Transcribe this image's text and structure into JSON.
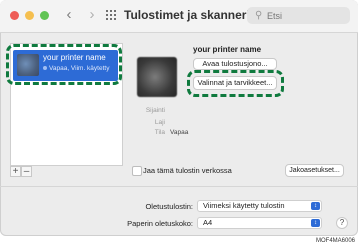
{
  "window": {
    "title": "Tulostimet ja skannerit",
    "search_placeholder": "Etsi"
  },
  "sidebar": {
    "printer": {
      "name": "your printer name",
      "status": "Vapaa, Viim. käytetty"
    },
    "add_label": "+",
    "remove_label": "–"
  },
  "detail": {
    "printer_name": "your printer name",
    "open_queue_label": "Avaa tulostusjono...",
    "options_supplies_label": "Valinnat ja tarvikkeet...",
    "info": [
      {
        "label": "Sijainti",
        "value": ""
      },
      {
        "label": "Laji",
        "value": ""
      },
      {
        "label": "Tila",
        "value": "Vapaa"
      }
    ],
    "share_label": "Jaa tämä tulostin verkossa",
    "sharing_prefs_label": "Jakoasetukset..."
  },
  "footer": {
    "default_printer_label": "Oletustulostin:",
    "default_printer_value": "Viimeksi käytetty tulostin",
    "paper_size_label": "Paperin oletuskoko:",
    "paper_size_value": "A4",
    "help_label": "?"
  },
  "image_code": "MOF4MA6006",
  "colors": {
    "selection": "#2d6bd6",
    "highlight": "#0f7a3e"
  }
}
